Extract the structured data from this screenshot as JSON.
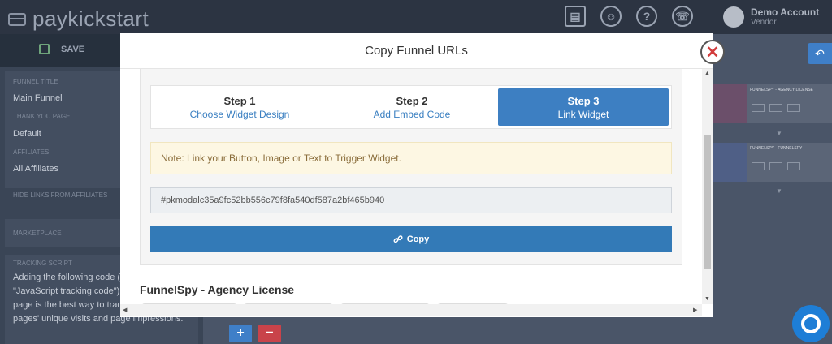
{
  "app": {
    "brand": "paykickstart",
    "account_name": "Demo Account",
    "account_role": "Vendor",
    "save_label": "SAVE"
  },
  "sidebar": {
    "funnel_title_label": "FUNNEL TITLE",
    "funnel_title_value": "Main Funnel",
    "thank_you_label": "THANK YOU PAGE",
    "thank_you_value": "Default",
    "affiliates_label": "AFFILIATES",
    "affiliates_value": "All Affiliates",
    "hide_links_label": "HIDE LINKS FROM AFFILIATES",
    "marketplace_label": "MARKETPLACE",
    "tracking_label": "TRACKING SCRIPT",
    "tracking_text": "Adding the following code (known as \"JavaScript tracking code\") to your landing page is the best way to track product landing pages' unique visits and page impressions."
  },
  "background": {
    "thumb1_title": "FUNNELSPY - AGENCY LICENSE",
    "thumb2_title": "FUNNELSPY - FUNNELSPY"
  },
  "modal": {
    "title": "Copy Funnel URLs",
    "steps": [
      {
        "title": "Step 1",
        "subtitle": "Choose Widget Design",
        "active": false
      },
      {
        "title": "Step 2",
        "subtitle": "Add Embed Code",
        "active": false
      },
      {
        "title": "Step 3",
        "subtitle": "Link Widget",
        "active": true
      }
    ],
    "note": "Note: Link your Button, Image or Text to Trigger Widget.",
    "code_value": "#pkmodalc35a9fc52bb556c79f8fa540df587a2bf465b940",
    "copy_label": "Copy",
    "section_title": "FunnelSpy - Agency License"
  },
  "icons": {
    "brand": "card-icon",
    "store": "store-icon",
    "user": "user-icon",
    "help": "question-icon",
    "support": "support-icon",
    "save": "floppy-icon",
    "link": "link-icon",
    "close": "close-icon",
    "back": "undo-icon",
    "help_fab": "lifebuoy-icon"
  },
  "colors": {
    "primary": "#337ab7",
    "step_active": "#3d7fc2",
    "danger": "#c9434a",
    "note_bg": "#fdf7e3",
    "note_text": "#8a6d3b"
  }
}
